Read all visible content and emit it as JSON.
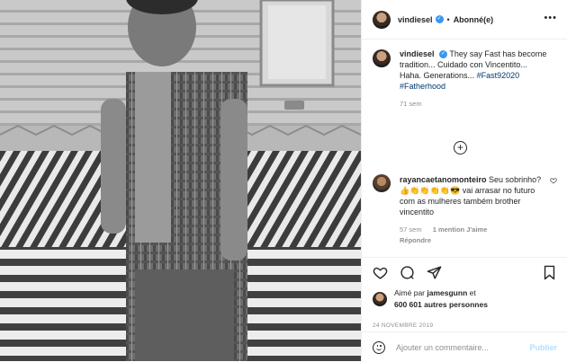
{
  "header": {
    "username": "vindiesel",
    "follow_status": "Abonné(e)",
    "separator": "•",
    "more": "•••"
  },
  "caption": {
    "username": "vindiesel",
    "line1": "They say Fast has become tradition... Cuidado con Vincentito...",
    "line2": "Haha. Generations...",
    "tag1": "#Fast92020",
    "tag2": "#Fatherhood",
    "age": "71 sem"
  },
  "comment": {
    "username": "rayancaetanomonteiro",
    "text": "Seu sobrinho?👍👏👏👏👏😎 vai arrasar no futuro com as mulheres também brother vincentito",
    "age": "57 sem",
    "likes": "1 mention J'aime",
    "reply": "Répondre"
  },
  "load_more": "+",
  "likes": {
    "prefix": "Aimé par",
    "user": "jamesgunn",
    "conj": "et",
    "others": "600 601 autres personnes"
  },
  "date": "24 NOVEMBRE 2019",
  "add_comment": {
    "placeholder": "Ajouter un commentaire...",
    "publish": "Publier"
  },
  "colors": {
    "link": "#00376b",
    "muted": "#8e8e8e",
    "verified": "#3897f0",
    "publish_disabled": "#b2dffc"
  }
}
